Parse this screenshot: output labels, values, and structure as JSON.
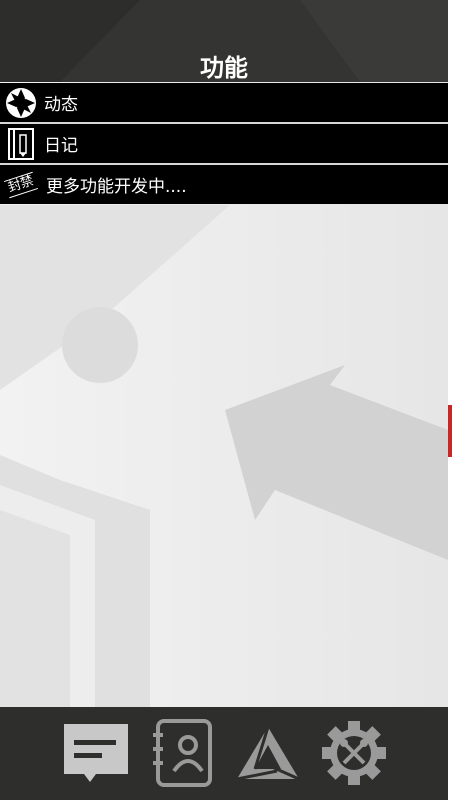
{
  "header": {
    "title": "功能"
  },
  "menu": {
    "items": [
      {
        "label": "动态",
        "icon": "aperture-icon"
      },
      {
        "label": "日记",
        "icon": "notebook-icon"
      },
      {
        "label": "更多功能开发中....",
        "icon": "sealed-stamp-icon",
        "stamp_text": "封禁"
      }
    ]
  },
  "tabbar": {
    "tabs": [
      {
        "icon": "message-icon",
        "active": true
      },
      {
        "icon": "contacts-icon",
        "active": false
      },
      {
        "icon": "triangle-logo-icon",
        "active": false
      },
      {
        "icon": "settings-gear-icon",
        "active": false
      }
    ]
  },
  "colors": {
    "header_bg": "#343432",
    "row_bg": "#000000",
    "content_bg": "#ebebeb",
    "tabbar_bg": "#2e2e2c",
    "icon_active": "#c8c8c8",
    "icon_inactive": "#9a9a9a"
  }
}
